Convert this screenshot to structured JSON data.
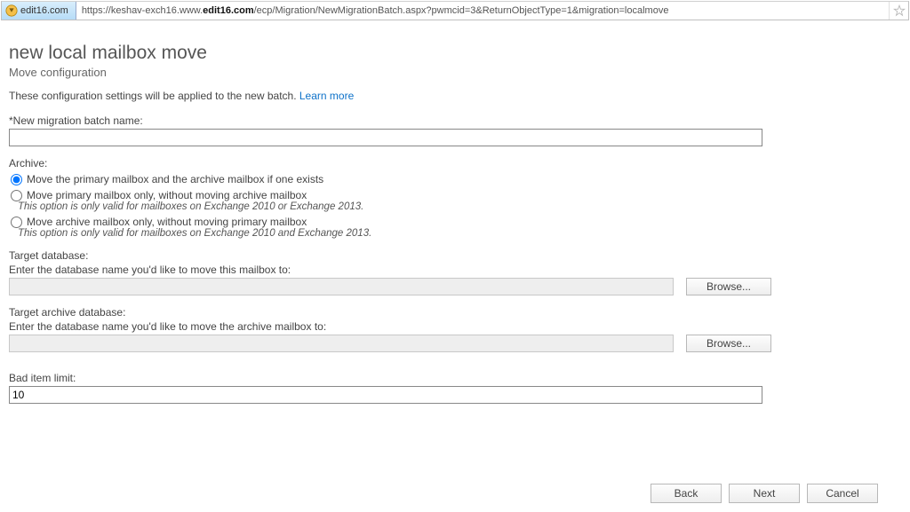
{
  "address_bar": {
    "site_label": "edit16.com",
    "url_pre": "https://keshav-exch16.www.",
    "url_bold": "edit16.com",
    "url_post": "/ecp/Migration/NewMigrationBatch.aspx?pwmcid=3&ReturnObjectType=1&migration=localmove"
  },
  "page": {
    "title": "new local mailbox move",
    "subtitle": "Move configuration",
    "description": "These configuration settings will be applied to the new batch.",
    "learn_more": "Learn more"
  },
  "batch_name": {
    "label": "*New migration batch name:",
    "value": ""
  },
  "archive": {
    "heading": "Archive:",
    "opt1": "Move the primary mailbox and the archive mailbox if one exists",
    "opt2": "Move primary mailbox only, without moving archive mailbox",
    "note2": "This option is only valid for mailboxes on Exchange 2010 or Exchange 2013.",
    "opt3": "Move archive mailbox only, without moving primary mailbox",
    "note3": "This option is only valid for mailboxes on Exchange 2010 and Exchange 2013."
  },
  "target_db": {
    "label": "Target database:",
    "helper": "Enter the database name you'd like to move this mailbox to:",
    "browse": "Browse...",
    "value": ""
  },
  "target_archive_db": {
    "label": "Target archive database:",
    "helper": "Enter the database name you'd like to move the archive mailbox to:",
    "browse": "Browse...",
    "value": ""
  },
  "bad_item": {
    "label": "Bad item limit:",
    "value": "10"
  },
  "footer": {
    "back": "Back",
    "next": "Next",
    "cancel": "Cancel"
  }
}
